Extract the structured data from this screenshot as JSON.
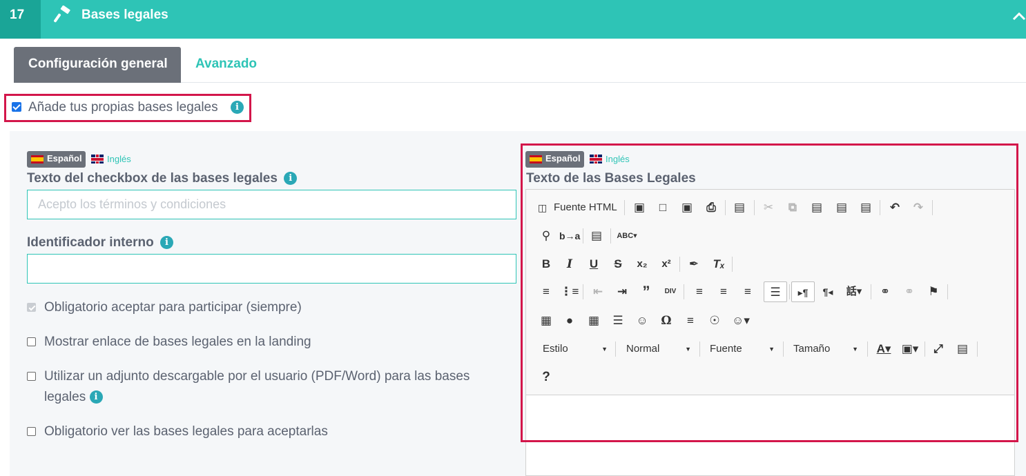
{
  "header": {
    "step": "17",
    "title": "Bases legales",
    "icon": "gavel-icon",
    "chevron": "chevron-up-icon",
    "color": "#2ec4b6"
  },
  "tabs": {
    "active": "Configuración general",
    "other": "Avanzado"
  },
  "own_legal": {
    "label": "Añade tus propias bases legales",
    "checked": true
  },
  "left": {
    "lang_active": "Español",
    "lang_other": "Inglés",
    "checkbox_text_label": "Texto del checkbox de las bases legales",
    "checkbox_text_placeholder": "Acepto los términos y condiciones",
    "internal_id_label": "Identificador interno",
    "internal_id_value": "",
    "options": [
      {
        "label": "Obligatorio aceptar para participar (siempre)",
        "checked": true,
        "disabled": true
      },
      {
        "label": "Mostrar enlace de bases legales en la landing",
        "checked": false
      },
      {
        "label": "Utilizar un adjunto descargable por el usuario (PDF/Word) para las bases legales",
        "checked": false
      },
      {
        "label": "Obligatorio ver las bases legales para aceptarlas",
        "checked": false
      }
    ]
  },
  "right": {
    "lang_active": "Español",
    "lang_other": "Inglés",
    "title": "Texto de las Bases Legales",
    "editor": {
      "source_label": "Fuente HTML",
      "combo_style": "Estilo",
      "combo_format": "Normal",
      "combo_font": "Fuente",
      "combo_size": "Tamaño",
      "help": "?"
    }
  },
  "accent": "#d3164a"
}
